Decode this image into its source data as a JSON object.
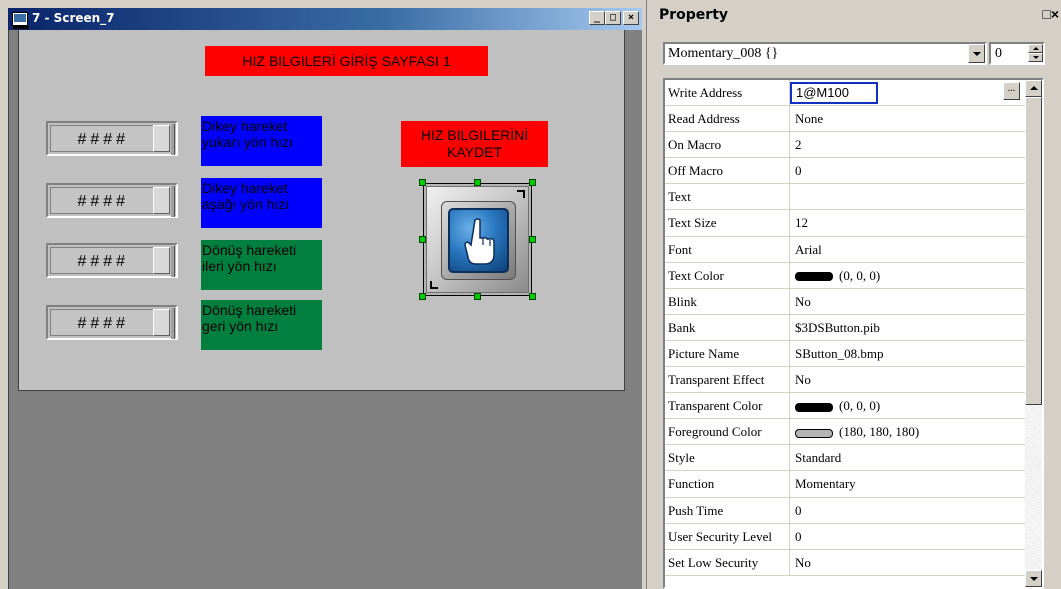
{
  "screen_window": {
    "title": "7 - Screen_7",
    "caption_buttons": {
      "minimize": "_",
      "maximize": "□",
      "close": "×"
    },
    "hmi": {
      "title_banner": "HIZ BILGILERİ GİRİŞ SAYFASI 1",
      "numeric_inputs": [
        {
          "value": "####",
          "label_line1": "Dikey hareket",
          "label_line2": "yukarı yön hızı",
          "label_color": "#0000ff"
        },
        {
          "value": "####",
          "label_line1": "Dikey hareket",
          "label_line2": "aşağı yön hızı",
          "label_color": "#0000ff"
        },
        {
          "value": "####",
          "label_line1": "Dönüş hareketi",
          "label_line2": "ileri yön hızı",
          "label_color": "#007f3f"
        },
        {
          "value": "####",
          "label_line1": "Dönüş hareketi",
          "label_line2": "geri yön hızı",
          "label_color": "#007f3f"
        }
      ],
      "save_banner_line1": "HIZ BILGILERİNİ",
      "save_banner_line2": "KAYDET",
      "momentary_button_icon": "hand-pointer-icon"
    }
  },
  "property_panel": {
    "header_title": "Property",
    "header_icons": "□×",
    "object_selector": "Momentary_008 {}",
    "spin_value": "0",
    "edit_button_label": "...",
    "properties": [
      {
        "key": "Write Address",
        "value": "1@M100",
        "editing": true
      },
      {
        "key": "Read Address",
        "value": "None"
      },
      {
        "key": "On Macro",
        "value": "2"
      },
      {
        "key": "Off Macro",
        "value": "0"
      },
      {
        "key": "Text",
        "value": ""
      },
      {
        "key": "Text Size",
        "value": "12"
      },
      {
        "key": "Font",
        "value": "Arial"
      },
      {
        "key": "Text Color",
        "value": "(0, 0, 0)",
        "swatch": "#000000"
      },
      {
        "key": "Blink",
        "value": "No"
      },
      {
        "key": "Bank",
        "value": "$3DSButton.pib"
      },
      {
        "key": "Picture Name",
        "value": "SButton_08.bmp"
      },
      {
        "key": "Transparent Effect",
        "value": "No"
      },
      {
        "key": "Transparent Color",
        "value": "(0, 0, 0)",
        "swatch": "#000000"
      },
      {
        "key": "Foreground Color",
        "value": "(180, 180, 180)",
        "swatch": "#b4b4b4"
      },
      {
        "key": "Style",
        "value": "Standard"
      },
      {
        "key": "Function",
        "value": "Momentary"
      },
      {
        "key": "Push Time",
        "value": "0"
      },
      {
        "key": "User Security Level",
        "value": "0"
      },
      {
        "key": "Set Low Security",
        "value": "No"
      }
    ]
  }
}
